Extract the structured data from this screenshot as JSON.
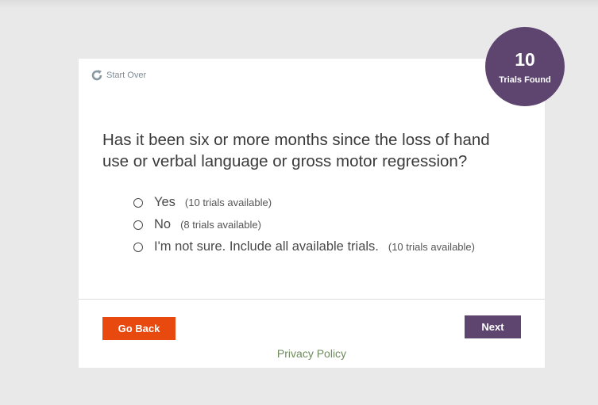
{
  "header": {
    "start_over_label": "Start Over",
    "start_over_icon": "refresh-icon"
  },
  "badge": {
    "count": "10",
    "label": "Trials Found",
    "color": "#5e4570"
  },
  "question": {
    "text": "Has it been six or more months since the loss of hand use or verbal language or gross motor regression?"
  },
  "options": [
    {
      "label": "Yes",
      "count": "(10 trials available)",
      "selected": false
    },
    {
      "label": "No",
      "count": "(8 trials available)",
      "selected": false
    },
    {
      "label": "I'm not sure. Include all available trials.",
      "count": "(10 trials available)",
      "selected": false
    }
  ],
  "footer": {
    "back_label": "Go Back",
    "next_label": "Next",
    "privacy_label": "Privacy Policy"
  },
  "colors": {
    "accent_purple": "#5e4570",
    "back_orange": "#e8490f",
    "privacy_green": "#6f8a5d"
  }
}
